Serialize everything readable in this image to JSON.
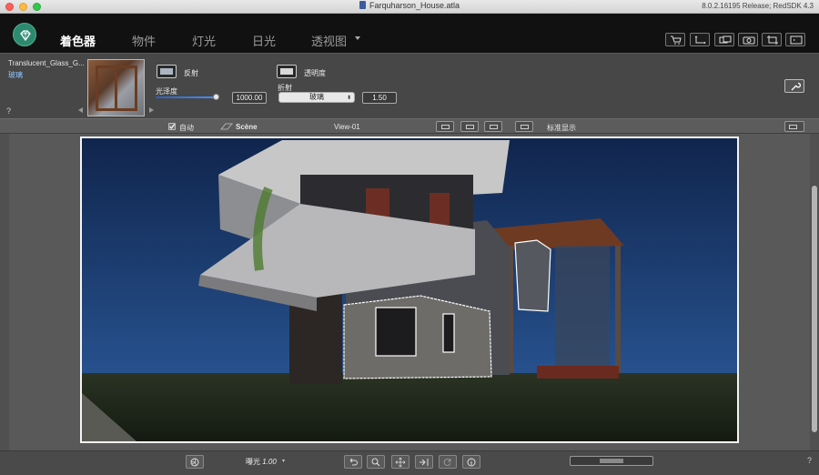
{
  "window": {
    "title": "Farquharson_House.atla",
    "version": "8.0.2.16195 Release; RedSDK 4.3"
  },
  "nav": {
    "tabs": [
      {
        "label": "着色器",
        "active": true
      },
      {
        "label": "物件",
        "active": false
      },
      {
        "label": "灯光",
        "active": false
      },
      {
        "label": "日光",
        "active": false
      },
      {
        "label": "透视图",
        "active": false
      }
    ],
    "toolbar_icons": [
      "cart-icon",
      "region-icon",
      "render-window-icon",
      "camera-icon",
      "crop-icon",
      "presentation-icon"
    ]
  },
  "material": {
    "name": "Translucent_Glass_G...",
    "type": "玻璃",
    "help": "?",
    "reflection_label": "反射",
    "reflection_color": "#a9b6c2",
    "gloss_label": "光泽度",
    "gloss_value": "1000.00",
    "transparency_label": "透明度",
    "transparency_color": "#d8d8d8",
    "refraction_label": "折射",
    "refraction_select": "玻璃",
    "refraction_value": "1.50",
    "tool_icon": "wrench-icon"
  },
  "viewport": {
    "auto_label": "自动",
    "auto_checked": true,
    "scene_label": "Scène",
    "view_name": "View-01",
    "display_mode": "标准显示"
  },
  "bottom": {
    "exposure_label": "曝光",
    "exposure_value": "1.00",
    "help": "?"
  },
  "colors": {
    "accent": "#2d8a6e",
    "sky": "#1a3a6c",
    "grass": "#1f2a1a",
    "selection_outline": "#ffffff"
  }
}
